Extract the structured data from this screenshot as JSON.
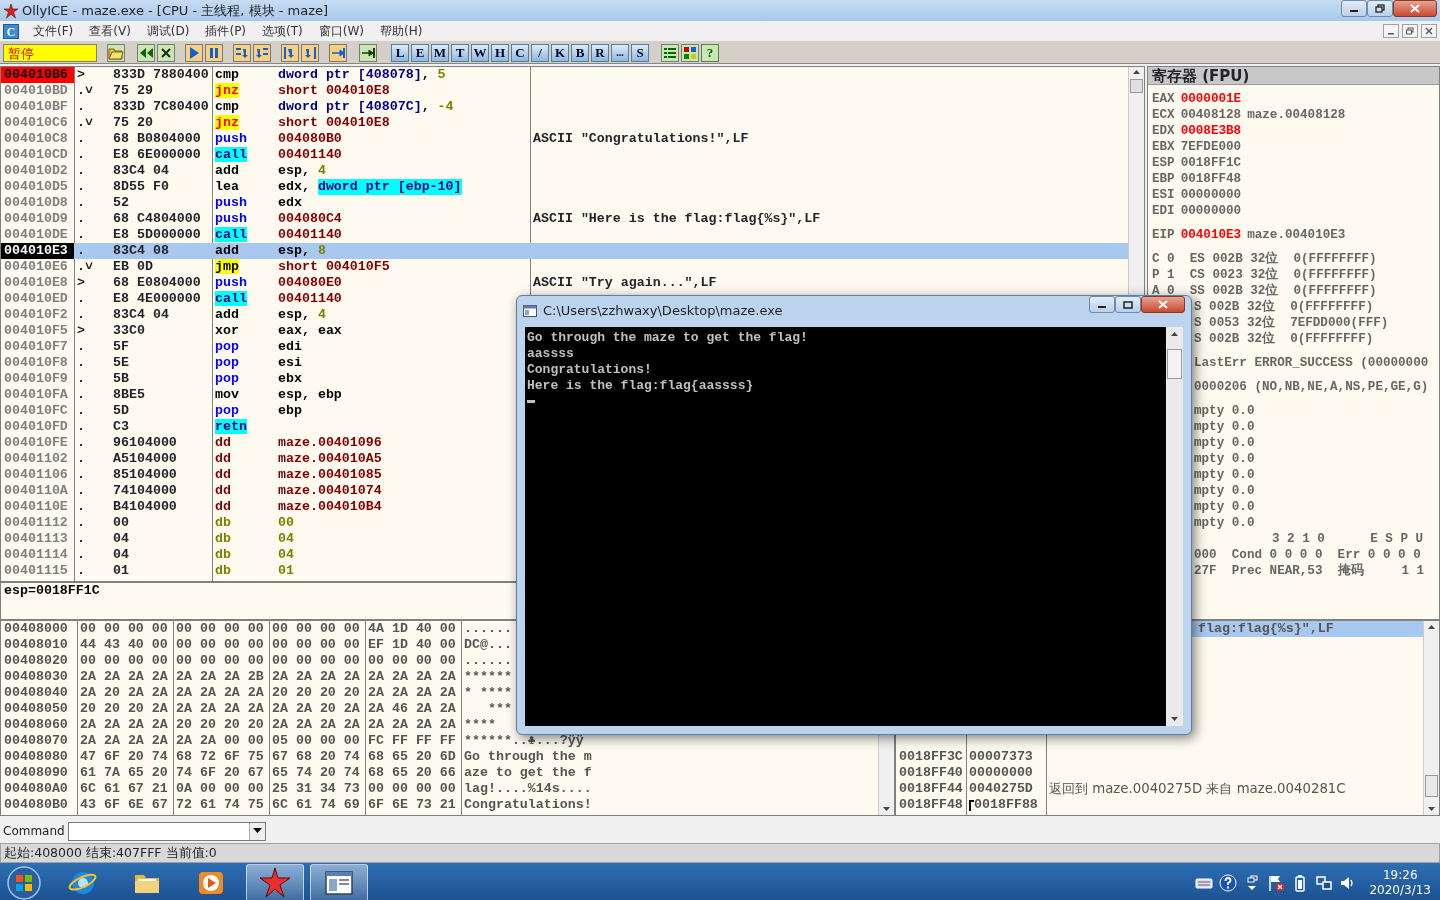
{
  "window": {
    "title": "OllyICE - maze.exe - [CPU -  主线程, 模块 - maze]"
  },
  "menu": {
    "mdi_icon": "C",
    "items": [
      "文件(F)",
      "查看(V)",
      "调试(D)",
      "插件(P)",
      "选项(T)",
      "窗口(W)",
      "帮助(H)"
    ]
  },
  "toolbar": {
    "status": "暂停",
    "letter_buttons": [
      "L",
      "E",
      "M",
      "T",
      "W",
      "H",
      "C",
      "/",
      "K",
      "B",
      "R",
      "...",
      "S"
    ],
    "help_button": "?"
  },
  "disassembly": {
    "rows": [
      {
        "address": "004010B6",
        "marker": ">",
        "hex": "833D 7880400",
        "mnemonic": "cmp",
        "kind": "plain",
        "operands": [
          {
            "kind": "mem",
            "text": "dword ptr [408078]"
          },
          {
            "kind": "reg",
            "text": ", "
          },
          {
            "kind": "const",
            "text": "5"
          }
        ],
        "breakpoint": true,
        "current": false,
        "selected": false
      },
      {
        "address": "004010BD",
        "marker": ".˅",
        "hex": "75 29",
        "mnemonic": "jnz",
        "kind": "jcc",
        "operands": [
          {
            "kind": "addr",
            "text": "short 004010E8"
          }
        ],
        "breakpoint": false,
        "current": false,
        "selected": false
      },
      {
        "address": "004010BF",
        "marker": ".",
        "hex": "833D 7C80400",
        "mnemonic": "cmp",
        "kind": "plain",
        "operands": [
          {
            "kind": "mem",
            "text": "dword ptr [40807C]"
          },
          {
            "kind": "reg",
            "text": ", "
          },
          {
            "kind": "const",
            "text": "-4"
          }
        ],
        "breakpoint": false,
        "current": false,
        "selected": false
      },
      {
        "address": "004010C6",
        "marker": ".˅",
        "hex": "75 20",
        "mnemonic": "jnz",
        "kind": "jcc",
        "operands": [
          {
            "kind": "addr",
            "text": "short 004010E8"
          }
        ],
        "breakpoint": false,
        "current": false,
        "selected": false
      },
      {
        "address": "004010C8",
        "marker": ".",
        "hex": "68 B0804000",
        "mnemonic": "push",
        "kind": "stack",
        "operands": [
          {
            "kind": "addr",
            "text": "004080B0"
          }
        ],
        "comment": "ASCII \"Congratulations!\",LF",
        "breakpoint": false,
        "current": false,
        "selected": false
      },
      {
        "address": "004010CD",
        "marker": ".",
        "hex": "E8 6E000000",
        "mnemonic": "call",
        "kind": "call",
        "operands": [
          {
            "kind": "addr",
            "text": "00401140"
          }
        ],
        "breakpoint": false,
        "current": false,
        "selected": false
      },
      {
        "address": "004010D2",
        "marker": ".",
        "hex": "83C4 04",
        "mnemonic": "add",
        "kind": "plain",
        "operands": [
          {
            "kind": "reg",
            "text": "esp, "
          },
          {
            "kind": "const",
            "text": "4"
          }
        ],
        "breakpoint": false,
        "current": false,
        "selected": false
      },
      {
        "address": "004010D5",
        "marker": ".",
        "hex": "8D55 F0",
        "mnemonic": "lea",
        "kind": "plain",
        "operands": [
          {
            "kind": "reg",
            "text": "edx, "
          },
          {
            "kind": "memhl",
            "text": "dword ptr [ebp-10]"
          }
        ],
        "breakpoint": false,
        "current": false,
        "selected": false
      },
      {
        "address": "004010D8",
        "marker": ".",
        "hex": "52",
        "mnemonic": "push",
        "kind": "stack",
        "operands": [
          {
            "kind": "reg",
            "text": "edx"
          }
        ],
        "breakpoint": false,
        "current": false,
        "selected": false
      },
      {
        "address": "004010D9",
        "marker": ".",
        "hex": "68 C4804000",
        "mnemonic": "push",
        "kind": "stack",
        "operands": [
          {
            "kind": "addr",
            "text": "004080C4"
          }
        ],
        "comment": "ASCII \"Here is the flag:flag{%s}\",LF",
        "breakpoint": false,
        "current": false,
        "selected": false
      },
      {
        "address": "004010DE",
        "marker": ".",
        "hex": "E8 5D000000",
        "mnemonic": "call",
        "kind": "call",
        "operands": [
          {
            "kind": "addr",
            "text": "00401140"
          }
        ],
        "breakpoint": false,
        "current": false,
        "selected": false
      },
      {
        "address": "004010E3",
        "marker": ".",
        "hex": "83C4 08",
        "mnemonic": "add",
        "kind": "plain",
        "operands": [
          {
            "kind": "reg",
            "text": "esp, "
          },
          {
            "kind": "const",
            "text": "8"
          }
        ],
        "breakpoint": false,
        "current": true,
        "selected": true
      },
      {
        "address": "004010E6",
        "marker": ".˅",
        "hex": "EB 0D",
        "mnemonic": "jmp",
        "kind": "jmp",
        "operands": [
          {
            "kind": "addr",
            "text": "short 004010F5"
          }
        ],
        "breakpoint": false,
        "current": false,
        "selected": false
      },
      {
        "address": "004010E8",
        "marker": ">",
        "hex": "68 E0804000",
        "mnemonic": "push",
        "kind": "stack",
        "operands": [
          {
            "kind": "addr",
            "text": "004080E0"
          }
        ],
        "comment": "ASCII \"Try again...\",LF",
        "breakpoint": false,
        "current": false,
        "selected": false
      },
      {
        "address": "004010ED",
        "marker": ".",
        "hex": "E8 4E000000",
        "mnemonic": "call",
        "kind": "call",
        "operands": [
          {
            "kind": "addr",
            "text": "00401140"
          }
        ],
        "breakpoint": false,
        "current": false,
        "selected": false
      },
      {
        "address": "004010F2",
        "marker": ".",
        "hex": "83C4 04",
        "mnemonic": "add",
        "kind": "plain",
        "operands": [
          {
            "kind": "reg",
            "text": "esp, "
          },
          {
            "kind": "const",
            "text": "4"
          }
        ],
        "breakpoint": false,
        "current": false,
        "selected": false
      },
      {
        "address": "004010F5",
        "marker": ">",
        "hex": "33C0",
        "mnemonic": "xor",
        "kind": "plain",
        "operands": [
          {
            "kind": "reg",
            "text": "eax, eax"
          }
        ],
        "breakpoint": false,
        "current": false,
        "selected": false
      },
      {
        "address": "004010F7",
        "marker": ".",
        "hex": "5F",
        "mnemonic": "pop",
        "kind": "stack",
        "operands": [
          {
            "kind": "reg",
            "text": "edi"
          }
        ],
        "breakpoint": false,
        "current": false,
        "selected": false
      },
      {
        "address": "004010F8",
        "marker": ".",
        "hex": "5E",
        "mnemonic": "pop",
        "kind": "stack",
        "operands": [
          {
            "kind": "reg",
            "text": "esi"
          }
        ],
        "breakpoint": false,
        "current": false,
        "selected": false
      },
      {
        "address": "004010F9",
        "marker": ".",
        "hex": "5B",
        "mnemonic": "pop",
        "kind": "stack",
        "operands": [
          {
            "kind": "reg",
            "text": "ebx"
          }
        ],
        "breakpoint": false,
        "current": false,
        "selected": false
      },
      {
        "address": "004010FA",
        "marker": ".",
        "hex": "8BE5",
        "mnemonic": "mov",
        "kind": "plain",
        "operands": [
          {
            "kind": "reg",
            "text": "esp, ebp"
          }
        ],
        "breakpoint": false,
        "current": false,
        "selected": false
      },
      {
        "address": "004010FC",
        "marker": ".",
        "hex": "5D",
        "mnemonic": "pop",
        "kind": "stack",
        "operands": [
          {
            "kind": "reg",
            "text": "ebp"
          }
        ],
        "breakpoint": false,
        "current": false,
        "selected": false
      },
      {
        "address": "004010FD",
        "marker": ".",
        "hex": "C3",
        "mnemonic": "retn",
        "kind": "call",
        "operands": [],
        "breakpoint": false,
        "current": false,
        "selected": false
      },
      {
        "address": "004010FE",
        "marker": ".",
        "hex": "96104000",
        "mnemonic": "dd",
        "kind": "dd",
        "operands": [
          {
            "kind": "addr",
            "text": "maze.00401096"
          }
        ],
        "breakpoint": false,
        "current": false,
        "selected": false
      },
      {
        "address": "00401102",
        "marker": ".",
        "hex": "A5104000",
        "mnemonic": "dd",
        "kind": "dd",
        "operands": [
          {
            "kind": "addr",
            "text": "maze.004010A5"
          }
        ],
        "breakpoint": false,
        "current": false,
        "selected": false
      },
      {
        "address": "00401106",
        "marker": ".",
        "hex": "85104000",
        "mnemonic": "dd",
        "kind": "dd",
        "operands": [
          {
            "kind": "addr",
            "text": "maze.00401085"
          }
        ],
        "breakpoint": false,
        "current": false,
        "selected": false
      },
      {
        "address": "0040110A",
        "marker": ".",
        "hex": "74104000",
        "mnemonic": "dd",
        "kind": "dd",
        "operands": [
          {
            "kind": "addr",
            "text": "maze.00401074"
          }
        ],
        "breakpoint": false,
        "current": false,
        "selected": false
      },
      {
        "address": "0040110E",
        "marker": ".",
        "hex": "B4104000",
        "mnemonic": "dd",
        "kind": "dd",
        "operands": [
          {
            "kind": "addr",
            "text": "maze.004010B4"
          }
        ],
        "breakpoint": false,
        "current": false,
        "selected": false
      },
      {
        "address": "00401112",
        "marker": ".",
        "hex": "00",
        "mnemonic": "db",
        "kind": "db",
        "operands": [
          {
            "kind": "const",
            "text": "00"
          }
        ],
        "breakpoint": false,
        "current": false,
        "selected": false
      },
      {
        "address": "00401113",
        "marker": ".",
        "hex": "04",
        "mnemonic": "db",
        "kind": "db",
        "operands": [
          {
            "kind": "const",
            "text": "04"
          }
        ],
        "breakpoint": false,
        "current": false,
        "selected": false
      },
      {
        "address": "00401114",
        "marker": ".",
        "hex": "04",
        "mnemonic": "db",
        "kind": "db",
        "operands": [
          {
            "kind": "const",
            "text": "04"
          }
        ],
        "breakpoint": false,
        "current": false,
        "selected": false
      },
      {
        "address": "00401115",
        "marker": ".",
        "hex": "01",
        "mnemonic": "db",
        "kind": "db",
        "operands": [
          {
            "kind": "const",
            "text": "01"
          }
        ],
        "breakpoint": false,
        "current": false,
        "selected": false
      }
    ]
  },
  "info_pane": "esp=0018FF1C",
  "registers": {
    "title": "寄存器 (FPU)",
    "groups": [
      [
        {
          "kind": "reg",
          "name": "EAX",
          "value": "0000001E",
          "changed": true
        },
        {
          "kind": "reg",
          "name": "ECX",
          "value": "00408128",
          "changed": false,
          "comment": "maze.00408128"
        },
        {
          "kind": "reg",
          "name": "EDX",
          "value": "0008E3B8",
          "changed": true
        },
        {
          "kind": "reg",
          "name": "EBX",
          "value": "7EFDE000",
          "changed": false
        },
        {
          "kind": "reg",
          "name": "ESP",
          "value": "0018FF1C",
          "changed": false
        },
        {
          "kind": "reg",
          "name": "EBP",
          "value": "0018FF48",
          "changed": false
        },
        {
          "kind": "reg",
          "name": "ESI",
          "value": "00000000",
          "changed": false
        },
        {
          "kind": "reg",
          "name": "EDI",
          "value": "00000000",
          "changed": false
        }
      ],
      [
        {
          "kind": "reg",
          "name": "EIP",
          "value": "004010E3",
          "changed": true,
          "comment": "maze.004010E3"
        }
      ],
      [
        {
          "kind": "text",
          "text": "C 0  ES 002B 32位  0(FFFFFFFF)"
        },
        {
          "kind": "text",
          "text": "P 1  CS 0023 32位  0(FFFFFFFF)"
        },
        {
          "kind": "text",
          "text": "A 0  SS 002B 32位  0(FFFFFFFF)"
        },
        {
          "kind": "cut",
          "text": "S 002B 32位  0(FFFFFFFF)"
        },
        {
          "kind": "cut",
          "text": "S 0053 32位  7EFDD000(FFF)"
        },
        {
          "kind": "cut",
          "text": "S 002B 32位  0(FFFFFFFF)"
        }
      ],
      [
        {
          "kind": "cut",
          "text": "LastErr ERROR_SUCCESS (00000000"
        }
      ],
      [
        {
          "kind": "cut",
          "text": "0000206 (NO,NB,NE,A,NS,PE,GE,G)"
        }
      ],
      [
        {
          "kind": "cut",
          "text": "mpty 0.0"
        },
        {
          "kind": "cut",
          "text": "mpty 0.0"
        },
        {
          "kind": "cut",
          "text": "mpty 0.0"
        },
        {
          "kind": "cut",
          "text": "mpty 0.0"
        },
        {
          "kind": "cut",
          "text": "mpty 0.0"
        },
        {
          "kind": "cut",
          "text": "mpty 0.0"
        },
        {
          "kind": "cut",
          "text": "mpty 0.0"
        },
        {
          "kind": "cut",
          "text": "mpty 0.0"
        },
        {
          "kind": "fpu",
          "text": "3 2 1 0      E S P U"
        },
        {
          "kind": "cut",
          "text": "000  Cond 0 0 0 0  Err 0 0 0 0"
        },
        {
          "kind": "cut",
          "text": "27F  Prec NEAR,53  掩码     1 1"
        }
      ]
    ]
  },
  "dump": {
    "rows": [
      {
        "address": "00408000",
        "bytes": [
          "00 00 00 00",
          "00 00 00 00",
          "00 00 00 00",
          "4A 1D 40 00"
        ],
        "ascii": "......"
      },
      {
        "address": "00408010",
        "bytes": [
          "44 43 40 00",
          "00 00 00 00",
          "00 00 00 00",
          "EF 1D 40 00"
        ],
        "ascii": "DC@..."
      },
      {
        "address": "00408020",
        "bytes": [
          "00 00 00 00",
          "00 00 00 00",
          "00 00 00 00",
          "00 00 00 00"
        ],
        "ascii": "......"
      },
      {
        "address": "00408030",
        "bytes": [
          "2A 2A 2A 2A",
          "2A 2A 2A 2B",
          "2A 2A 2A 2A",
          "2A 2A 2A 2A"
        ],
        "ascii": "******"
      },
      {
        "address": "00408040",
        "bytes": [
          "2A 20 2A 2A",
          "2A 2A 2A 2A",
          "20 20 20 20",
          "2A 2A 2A 2A"
        ],
        "ascii": "* ****"
      },
      {
        "address": "00408050",
        "bytes": [
          "20 20 20 2A",
          "2A 2A 2A 2A",
          "2A 2A 20 2A",
          "2A 46 2A 2A"
        ],
        "ascii": "   ***"
      },
      {
        "address": "00408060",
        "bytes": [
          "2A 2A 2A 2A",
          "20 20 20 20",
          "2A 2A 2A 2A",
          "2A 2A 2A 2A"
        ],
        "ascii": "****"
      },
      {
        "address": "00408070",
        "bytes": [
          "2A 2A 2A 2A",
          "2A 2A 00 00",
          "05 00 00 00",
          "FC FF FF FF"
        ],
        "ascii": "******..♣...?ÿÿ"
      },
      {
        "address": "00408080",
        "bytes": [
          "47 6F 20 74",
          "68 72 6F 75",
          "67 68 20 74",
          "68 65 20 6D"
        ],
        "ascii": "Go through the m"
      },
      {
        "address": "00408090",
        "bytes": [
          "61 7A 65 20",
          "74 6F 20 67",
          "65 74 20 74",
          "68 65 20 66"
        ],
        "ascii": "aze to get the f"
      },
      {
        "address": "004080A0",
        "bytes": [
          "6C 61 67 21",
          "0A 00 00 00",
          "25 31 34 73",
          "00 00 00 00"
        ],
        "ascii": "lag!....%14s...."
      },
      {
        "address": "004080B0",
        "bytes": [
          "43 6F 6E 67",
          "72 61 74 75",
          "6C 61 74 69",
          "6F 6E 73 21"
        ],
        "ascii": "Congratulations!"
      }
    ]
  },
  "stack": {
    "rows": [
      {
        "kind": "cut",
        "comment": "flag:flag{%s}\",LF",
        "selected": true
      },
      {
        "kind": "entry",
        "address": "0018FF3C",
        "value": "00007373",
        "selected": false
      },
      {
        "kind": "entry",
        "address": "0018FF40",
        "value": "00000000",
        "selected": false
      },
      {
        "kind": "entry",
        "address": "0018FF44",
        "value": "0040275D",
        "comment": "返回到 maze.0040275D 来自 maze.0040281C",
        "selected": false
      },
      {
        "kind": "entry",
        "address": "0018FF48",
        "value": "0018FF88",
        "frame_start": true,
        "selected": false
      }
    ]
  },
  "command_bar": {
    "label": "Command"
  },
  "status_bar": "起始:408000 结束:407FFF 当前值:0",
  "console": {
    "title": "C:\\Users\\zzhwaxy\\Desktop\\maze.exe",
    "lines": [
      "Go through the maze to get the flag!",
      "aassss",
      "Congratulations!",
      "Here is the flag:flag{aassss}"
    ]
  },
  "taskbar": {
    "apps": [
      {
        "kind": "browser",
        "active": false
      },
      {
        "kind": "folder",
        "active": false
      },
      {
        "kind": "player",
        "active": false
      },
      {
        "kind": "debugger",
        "active": true
      },
      {
        "kind": "console",
        "active": true
      }
    ],
    "time": "19:26",
    "date": "2020/3/13"
  }
}
